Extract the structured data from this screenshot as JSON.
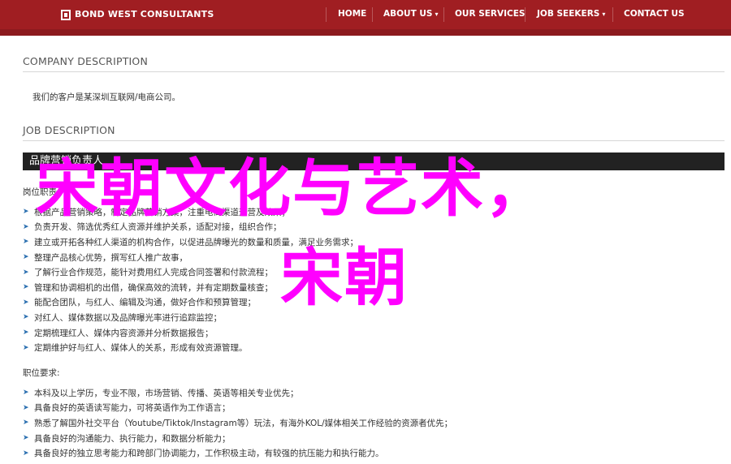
{
  "brand": {
    "logo_text": "BOND WEST CONSULTANTS"
  },
  "nav": {
    "items": [
      {
        "label": "HOME",
        "has_dropdown": false
      },
      {
        "label": "ABOUT US",
        "has_dropdown": true
      },
      {
        "label": "OUR SERVICES",
        "has_dropdown": false
      },
      {
        "label": "JOB SEEKERS",
        "has_dropdown": true
      },
      {
        "label": "CONTACT US",
        "has_dropdown": false
      }
    ],
    "dropdown_glyph": "▾"
  },
  "company": {
    "heading": "COMPANY DESCRIPTION",
    "text": "我们的客户是某深圳互联网/电商公司。"
  },
  "job": {
    "heading": "JOB DESCRIPTION",
    "title": "品牌营销负责人",
    "responsibilities_label": "岗位职责:",
    "responsibilities": [
      "根据产品营销策略，制定品牌营销方案，注重电商渠道运营及效果；",
      "负责开发、筛选优秀红人资源并维护关系，适配对接，组织合作；",
      "建立或开拓各种红人渠道的机构合作，以促进品牌曝光的数量和质量，满足业务需求；",
      "整理产品核心优势，撰写红人推广故事，",
      "了解行业合作规范，能针对费用红人完成合同签署和付款流程；",
      "管理和协调相机的出借，确保高效的流转，并有定期数量核查；",
      "能配合团队，与红人、编辑及沟通，做好合作和预算管理；",
      "对红人、媒体数据以及品牌曝光率进行追踪监控；",
      "定期梳理红人、媒体内容资源并分析数据报告；",
      "定期维护好与红人、媒体人的关系，形成有效资源管理。"
    ],
    "requirements_label": "职位要求:",
    "requirements": [
      "本科及以上学历，专业不限，市场营销、传播、英语等相关专业优先；",
      "具备良好的英语读写能力，可将英语作为工作语言；",
      "熟悉了解国外社交平台（Youtube/Tiktok/Instagram等）玩法，有海外KOL/媒体相关工作经验的资源者优先；",
      "具备良好的沟通能力、执行能力，和数据分析能力；",
      "具备良好的独立思考能力和跨部门协调能力，工作积极主动，有较强的抗压能力和执行能力。"
    ]
  },
  "overlay": {
    "line1": "宋朝文化与艺术，",
    "line2": "宋朝"
  },
  "colors": {
    "nav_bg": "#a01e22",
    "title_bar_bg": "#222222",
    "overlay_text": "#ff00ff",
    "bullet": "#2a6fb0"
  }
}
